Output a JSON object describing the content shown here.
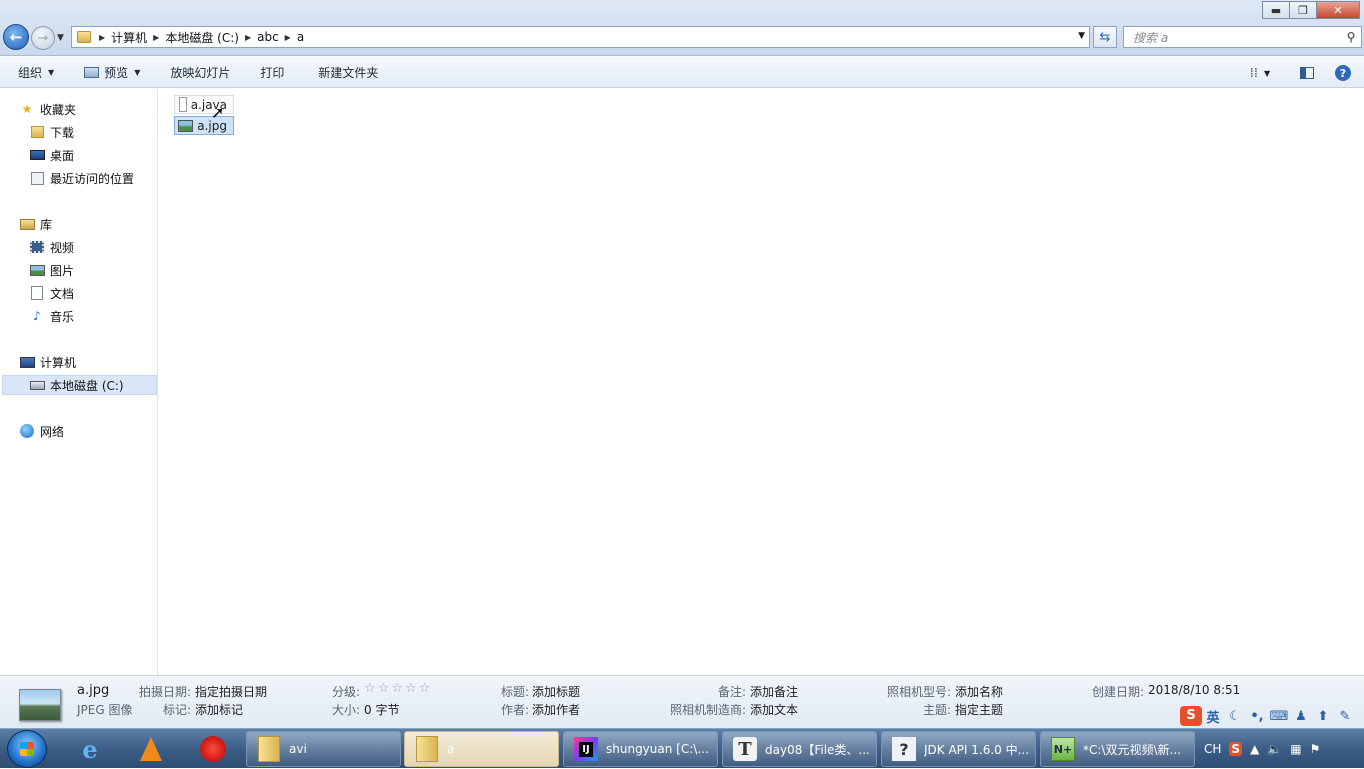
{
  "window": {
    "controls": {
      "minimize": "▬",
      "maximize": "❐",
      "close": "✕"
    }
  },
  "nav": {
    "back_icon": "back-arrow-icon",
    "forward_icon": "forward-arrow-icon"
  },
  "address": {
    "crumbs": [
      "计算机",
      "本地磁盘 (C:)",
      "abc",
      "a"
    ]
  },
  "search": {
    "placeholder": "搜索 a"
  },
  "toolbar": {
    "organize": "组织",
    "preview": "预览",
    "slideshow": "放映幻灯片",
    "print": "打印",
    "new_folder": "新建文件夹"
  },
  "sidebar": {
    "favorites": {
      "label": "收藏夹",
      "items": [
        "下载",
        "桌面",
        "最近访问的位置"
      ]
    },
    "libraries": {
      "label": "库",
      "items": [
        "视频",
        "图片",
        "文档",
        "音乐"
      ]
    },
    "computer": {
      "label": "计算机",
      "items": [
        "本地磁盘 (C:)"
      ]
    },
    "network": {
      "label": "网络"
    }
  },
  "files": [
    {
      "name": "a.java",
      "type": "document",
      "state": "hover"
    },
    {
      "name": "a.jpg",
      "type": "image",
      "state": "selected"
    }
  ],
  "details": {
    "name": "a.jpg",
    "type": "JPEG 图像",
    "date_taken_label": "拍摄日期:",
    "date_taken_value": "指定拍摄日期",
    "tags_label": "标记:",
    "tags_value": "添加标记",
    "rating_label": "分级:",
    "rating_value": 0,
    "size_label": "大小:",
    "size_value": "0 字节",
    "title_label": "标题:",
    "title_value": "添加标题",
    "authors_label": "作者:",
    "authors_value": "添加作者",
    "comments_label": "备注:",
    "comments_value": "添加备注",
    "maker_label": "照相机制造商:",
    "maker_value": "添加文本",
    "model_label": "照相机型号:",
    "model_value": "添加名称",
    "subject_label": "主题:",
    "subject_value": "指定主题",
    "created_label": "创建日期:",
    "created_value": "2018/8/10 8:51"
  },
  "ime": {
    "lang": "英"
  },
  "taskbar": {
    "tasks": [
      {
        "label": "avi",
        "icon": "folder-icon"
      },
      {
        "label": "a",
        "icon": "folder-icon",
        "active": true
      },
      {
        "label": "shungyuan [C:\\...",
        "icon": "intellij-icon"
      },
      {
        "label": "day08【File类、...",
        "icon": "typora-icon"
      },
      {
        "label": "JDK API 1.6.0 中...",
        "icon": "help-icon"
      },
      {
        "label": "*C:\\双元视频\\新...",
        "icon": "notepad-icon"
      }
    ],
    "tray": {
      "lang": "CH"
    }
  }
}
